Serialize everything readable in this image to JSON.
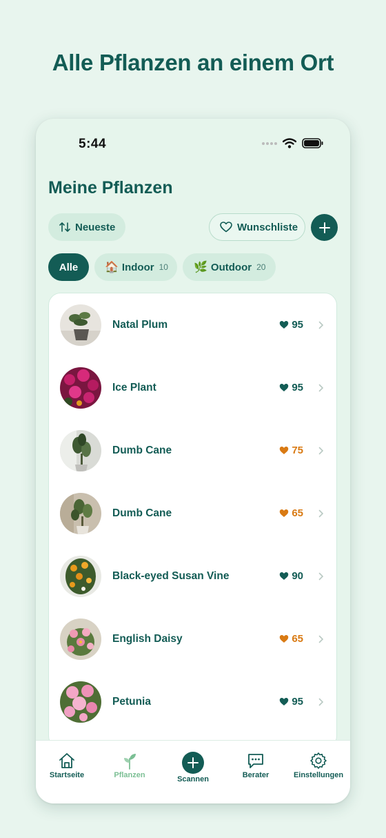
{
  "headline": "Alle Pflanzen an einem Ort",
  "status": {
    "time": "5:44"
  },
  "page_title": "Meine Pflanzen",
  "sort": {
    "label": "Neueste"
  },
  "wishlist": {
    "label": "Wunschliste"
  },
  "filters": {
    "all": {
      "label": "Alle"
    },
    "indoor": {
      "emoji": "🏠",
      "label": "Indoor",
      "count": "10"
    },
    "outdoor": {
      "emoji": "🌿",
      "label": "Outdoor",
      "count": "20"
    }
  },
  "plants": [
    {
      "name": "Natal Plum",
      "health": "95",
      "status": "good"
    },
    {
      "name": "Ice Plant",
      "health": "95",
      "status": "good"
    },
    {
      "name": "Dumb Cane",
      "health": "75",
      "status": "warn"
    },
    {
      "name": "Dumb Cane",
      "health": "65",
      "status": "warn"
    },
    {
      "name": "Black-eyed Susan Vine",
      "health": "90",
      "status": "good"
    },
    {
      "name": "English Daisy",
      "health": "65",
      "status": "warn"
    },
    {
      "name": "Petunia",
      "health": "95",
      "status": "good"
    }
  ],
  "nav": {
    "home": "Startseite",
    "plants": "Pflanzen",
    "scan": "Scannen",
    "advisor": "Berater",
    "settings": "Einstellungen"
  },
  "colors": {
    "primary": "#135c55",
    "good": "#135c55",
    "warn": "#d97a13",
    "background": "#e8f5ee"
  }
}
